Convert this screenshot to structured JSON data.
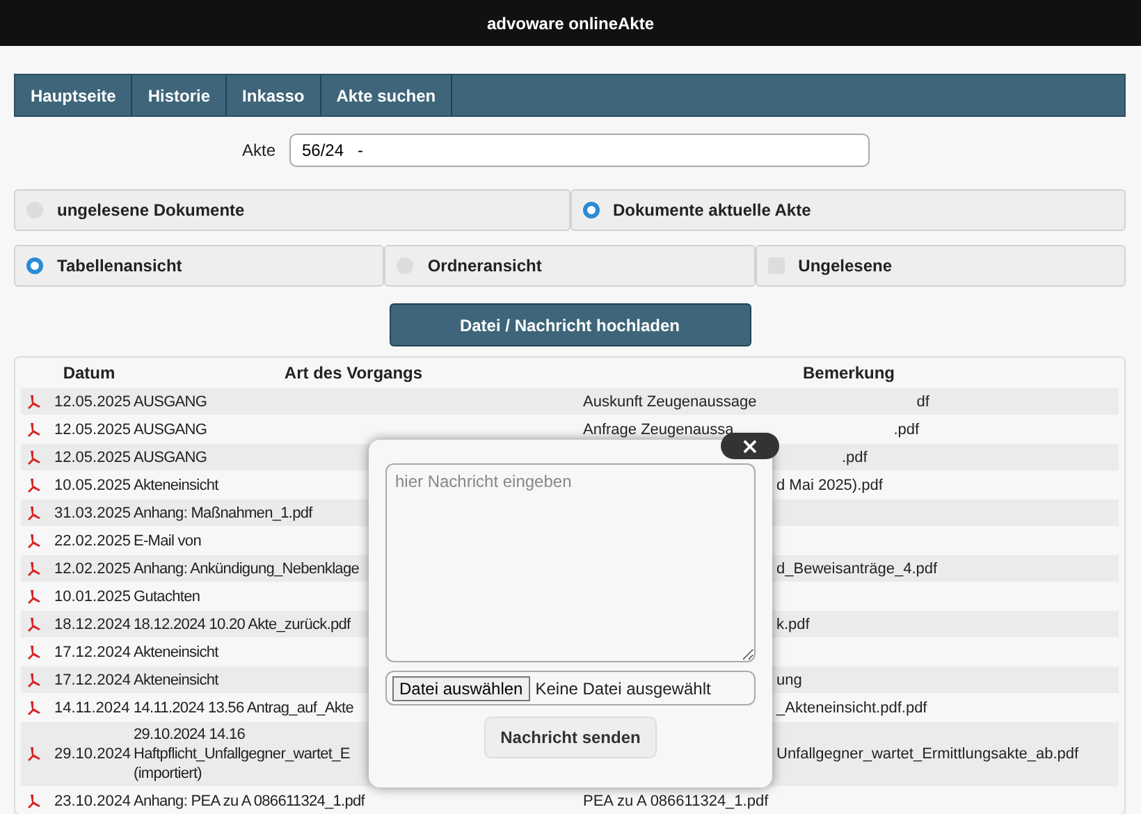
{
  "header": {
    "title": "advoware onlineAkte"
  },
  "nav": [
    {
      "label": "Hauptseite"
    },
    {
      "label": "Historie"
    },
    {
      "label": "Inkasso"
    },
    {
      "label": "Akte suchen"
    }
  ],
  "akte": {
    "label": "Akte",
    "value": "56/24   -"
  },
  "filter": [
    {
      "label": "ungelesene Dokumente",
      "selected": false
    },
    {
      "label": "Dokumente aktuelle Akte",
      "selected": true
    }
  ],
  "view": [
    {
      "kind": "radio",
      "label": "Tabellenansicht",
      "selected": true
    },
    {
      "kind": "radio",
      "label": "Ordneransicht",
      "selected": false
    },
    {
      "kind": "checkbox",
      "label": "Ungelesene",
      "checked": false
    }
  ],
  "upload_button": "Datei / Nachricht hochladen",
  "table": {
    "columns": [
      "Datum",
      "Art des Vorgangs",
      "Bemerkung"
    ],
    "rows": [
      {
        "date": "12.05.2025",
        "art": [
          "AUSGANG"
        ],
        "bemerkung": {
          "kind": "split",
          "parts": [
            "Auskunft Zeugenaussage",
            "df"
          ]
        }
      },
      {
        "date": "12.05.2025",
        "art": [
          "AUSGANG"
        ],
        "bemerkung": {
          "kind": "split",
          "parts": [
            "Anfrage Zeugenaussa",
            ".pdf"
          ]
        }
      },
      {
        "date": "12.05.2025",
        "art": [
          "AUSGANG"
        ],
        "bemerkung": {
          "kind": "far",
          "parts": [
            ".pdf"
          ]
        }
      },
      {
        "date": "10.05.2025",
        "art": [
          "Akteneinsicht"
        ],
        "bemerkung": {
          "kind": "cut",
          "parts": [
            "d Mai 2025).pdf"
          ]
        }
      },
      {
        "date": "31.03.2025",
        "art": [
          "Anhang: Maßnahmen_1.pdf"
        ]
      },
      {
        "date": "22.02.2025",
        "art": [
          "E-Mail von"
        ]
      },
      {
        "date": "12.02.2025",
        "art": [
          "Anhang: Ankündigung_Nebenklage"
        ],
        "bemerkung": {
          "kind": "cut",
          "parts": [
            "d_Beweisanträge_4.pdf"
          ]
        }
      },
      {
        "date": "10.01.2025",
        "art": [
          "Gutachten"
        ]
      },
      {
        "date": "18.12.2024",
        "art": [
          "18.12.2024 10.20 Akte_zurück.pdf"
        ],
        "bemerkung": {
          "kind": "cut",
          "parts": [
            "k.pdf"
          ]
        }
      },
      {
        "date": "17.12.2024",
        "art": [
          "Akteneinsicht"
        ]
      },
      {
        "date": "17.12.2024",
        "art": [
          "Akteneinsicht"
        ],
        "bemerkung": {
          "kind": "cut",
          "parts": [
            "ung"
          ]
        }
      },
      {
        "date": "14.11.2024",
        "art": [
          "14.11.2024 13.56 Antrag_auf_Akte"
        ],
        "bemerkung": {
          "kind": "cut",
          "parts": [
            "_Akteneinsicht.pdf.pdf"
          ]
        }
      },
      {
        "date": "29.10.2024",
        "art": [
          "29.10.2024 14.16",
          "Haftpflicht_Unfallgegner_wartet_E",
          "(importiert)"
        ],
        "bemerkung": {
          "kind": "cut",
          "parts": [
            "Unfallgegner_wartet_Ermittlungsakte_ab.pdf"
          ]
        }
      },
      {
        "date": "23.10.2024",
        "art": [
          "Anhang: PEA zu A 086611324_1.pdf"
        ],
        "bemerkung": {
          "kind": "plain",
          "parts": [
            "PEA zu A 086611324_1.pdf"
          ]
        }
      }
    ]
  },
  "modal": {
    "close": "×",
    "message": {
      "placeholder": "hier Nachricht eingeben"
    },
    "file_button": "Datei auswählen",
    "file_status": "Keine Datei ausgewählt",
    "send_button": "Nachricht senden"
  }
}
